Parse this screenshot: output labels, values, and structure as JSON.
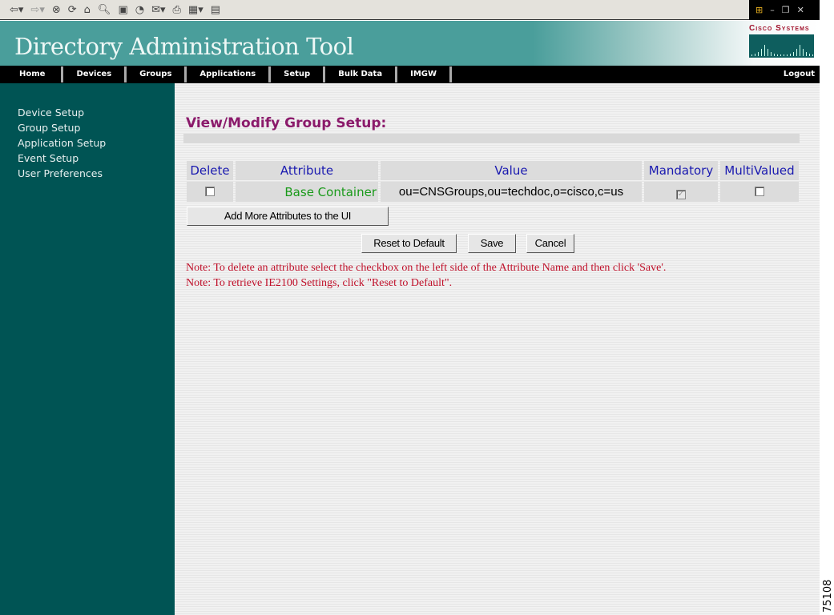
{
  "browser": {
    "toolbar_icons": [
      "back-icon",
      "forward-icon",
      "stop-icon",
      "refresh-icon",
      "home-icon",
      "search-icon",
      "favorites-icon",
      "history-icon",
      "mail-icon",
      "print-icon",
      "edit-icon",
      "discuss-icon"
    ]
  },
  "header": {
    "title": "Directory Administration Tool",
    "logo_text": "Cisco Systems"
  },
  "nav": {
    "items": [
      "Home",
      "Devices",
      "Groups",
      "Applications",
      "Setup",
      "Bulk Data",
      "IMGW"
    ],
    "logout": "Logout"
  },
  "sidebar": {
    "items": [
      "Device Setup",
      "Group Setup",
      "Application Setup",
      "Event Setup",
      "User Preferences"
    ]
  },
  "main": {
    "title": "View/Modify Group Setup:",
    "columns": [
      "Delete",
      "Attribute",
      "Value",
      "Mandatory",
      "MultiValued"
    ],
    "rows": [
      {
        "delete": false,
        "attribute": "Base Container",
        "value": "ou=CNSGroups,ou=techdoc,o=cisco,c=us",
        "mandatory": true,
        "multivalued": false
      }
    ],
    "add_button": "Add More Attributes to the UI",
    "reset_button": "Reset to Default",
    "save_button": "Save",
    "cancel_button": "Cancel",
    "notes": [
      "Note: To delete an attribute select the checkbox on the left side of the Attribute Name and then click 'Save'.",
      "Note: To retrieve IE2100 Settings, click \"Reset to Default\"."
    ]
  },
  "figure_number": "75108",
  "colors": {
    "header": "#4a9e9b",
    "sidebar": "#005454",
    "title": "#8b1a6b",
    "attribute": "#1a9a1a",
    "column_header": "#1a1ab0",
    "note": "#c0102a"
  }
}
